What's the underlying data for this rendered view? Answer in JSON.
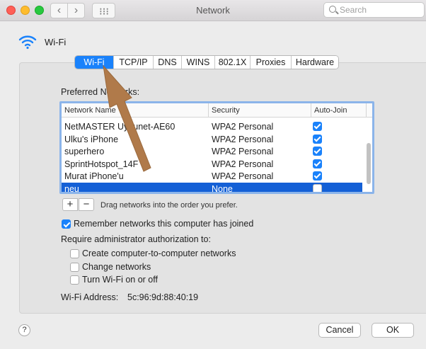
{
  "window": {
    "title": "Network"
  },
  "toolbar": {
    "search_placeholder": "Search"
  },
  "header": {
    "interface_name": "Wi-Fi"
  },
  "tabs": [
    {
      "label": "Wi-Fi",
      "active": true
    },
    {
      "label": "TCP/IP",
      "active": false
    },
    {
      "label": "DNS",
      "active": false
    },
    {
      "label": "WINS",
      "active": false
    },
    {
      "label": "802.1X",
      "active": false
    },
    {
      "label": "Proxies",
      "active": false
    },
    {
      "label": "Hardware",
      "active": false
    }
  ],
  "preferred": {
    "label": "Preferred Networks:",
    "columns": [
      "Network Name",
      "Security",
      "Auto-Join"
    ],
    "rows": [
      {
        "name": "NetMASTER Uydunet-AE60",
        "security": "WPA2 Personal",
        "auto_join": true,
        "selected": false
      },
      {
        "name": "Ulku's iPhone",
        "security": "WPA2 Personal",
        "auto_join": true,
        "selected": false
      },
      {
        "name": "superhero",
        "security": "WPA2 Personal",
        "auto_join": true,
        "selected": false
      },
      {
        "name": "SprintHotspot_14F",
        "security": "WPA2 Personal",
        "auto_join": true,
        "selected": false
      },
      {
        "name": "Murat iPhone'u",
        "security": "WPA2 Personal",
        "auto_join": true,
        "selected": false
      },
      {
        "name": "neu",
        "security": "None",
        "auto_join": false,
        "selected": true
      }
    ],
    "add_label": "+",
    "remove_label": "−",
    "drag_hint": "Drag networks into the order you prefer."
  },
  "options": {
    "remember": {
      "label": "Remember networks this computer has joined",
      "checked": true
    },
    "require_label": "Require administrator authorization to:",
    "require_items": [
      {
        "label": "Create computer-to-computer networks",
        "checked": false
      },
      {
        "label": "Change networks",
        "checked": false
      },
      {
        "label": "Turn Wi-Fi on or off",
        "checked": false
      }
    ]
  },
  "address": {
    "label": "Wi-Fi Address:",
    "value": "5c:96:9d:88:40:19"
  },
  "footer": {
    "help_label": "?",
    "cancel_label": "Cancel",
    "ok_label": "OK"
  },
  "colors": {
    "accent": "#1a82fb",
    "selection": "#1460d6",
    "annotation_arrow": "#b07a4a"
  }
}
